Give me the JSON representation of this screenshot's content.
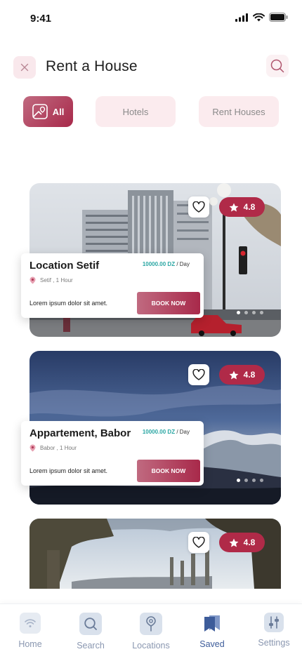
{
  "status_bar": {
    "time": "9:41"
  },
  "header": {
    "title": "Rent a House"
  },
  "tabs": [
    {
      "label": "All",
      "active": true
    },
    {
      "label": "Hotels",
      "active": false
    },
    {
      "label": "Rent Houses",
      "active": false
    }
  ],
  "cards": [
    {
      "title": "Location Setif",
      "price": "10000.00 DZ",
      "price_unit": "/ Day",
      "location": "Setif , 1 Hour",
      "description": "Lorem ipsum dolor sit amet.",
      "button": "BOOK NOW",
      "rating": "4.8",
      "image": "city buildings with street lamp"
    },
    {
      "title": "Appartement, Babor",
      "price": "10000.00 DZ",
      "price_unit": "/ Day",
      "location": "Babor , 1 Hour",
      "description": "Lorem ipsum dolor sit amet.",
      "button": "BOOK NOW",
      "rating": "4.8",
      "image": "snowy mountains at dusk"
    },
    {
      "rating": "4.8",
      "image": "ancient roman ruins columns"
    }
  ],
  "bottom_nav": [
    {
      "label": "Home",
      "icon": "wifi-home-icon",
      "active": false
    },
    {
      "label": "Search",
      "icon": "search-icon",
      "active": false
    },
    {
      "label": "Locations",
      "icon": "location-pin-icon",
      "active": false
    },
    {
      "label": "Saved",
      "icon": "bookmark-icon",
      "active": true
    },
    {
      "label": "Settings",
      "icon": "sliders-icon",
      "active": false
    }
  ],
  "colors": {
    "accent": "#a8294a",
    "accent_light": "#fbebee",
    "price": "#2aa6a3",
    "nav_active": "#3d5c9a",
    "nav_inactive": "#8a97b0"
  }
}
